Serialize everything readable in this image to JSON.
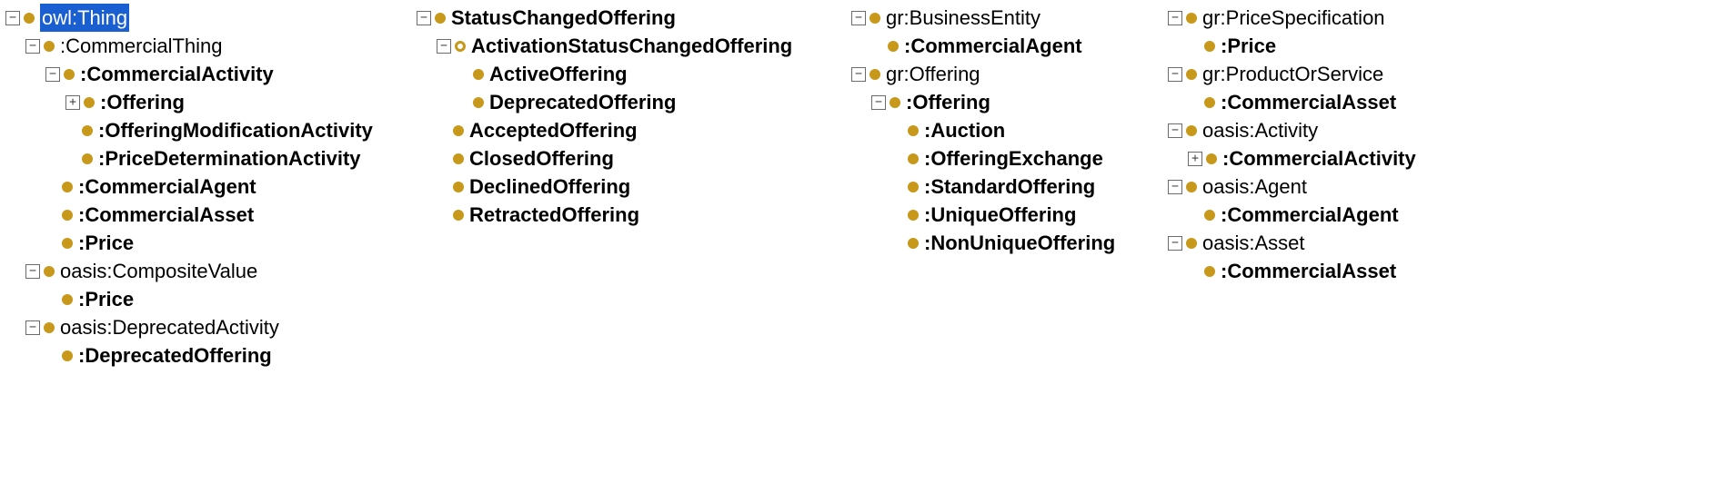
{
  "col1": {
    "owlThing": "owl:Thing",
    "commercialThing": ":CommercialThing",
    "commercialActivity": ":CommercialActivity",
    "offering": ":Offering",
    "offeringModificationActivity": ":OfferingModificationActivity",
    "priceDeterminationActivity": ":PriceDeterminationActivity",
    "commercialAgent": ":CommercialAgent",
    "commercialAsset": ":CommercialAsset",
    "price": ":Price",
    "compositeValue": "oasis:CompositeValue",
    "price2": ":Price",
    "deprecatedActivity": "oasis:DeprecatedActivity",
    "deprecatedOffering": ":DeprecatedOffering"
  },
  "col2": {
    "statusChangedOffering": "StatusChangedOffering",
    "activationStatusChangedOffering": "ActivationStatusChangedOffering",
    "activeOffering": "ActiveOffering",
    "deprecatedOffering": "DeprecatedOffering",
    "acceptedOffering": "AcceptedOffering",
    "closedOffering": "ClosedOffering",
    "declinedOffering": "DeclinedOffering",
    "retractedOffering": "RetractedOffering"
  },
  "col3": {
    "businessEntity": "gr:BusinessEntity",
    "commercialAgent": ":CommercialAgent",
    "grOffering": "gr:Offering",
    "offering": ":Offering",
    "auction": ":Auction",
    "offeringExchange": ":OfferingExchange",
    "standardOffering": ":StandardOffering",
    "uniqueOffering": ":UniqueOffering",
    "nonUniqueOffering": ":NonUniqueOffering"
  },
  "col4": {
    "priceSpecification": "gr:PriceSpecification",
    "price": ":Price",
    "productOrService": "gr:ProductOrService",
    "commercialAsset": ":CommercialAsset",
    "oasisActivity": "oasis:Activity",
    "commercialActivity": ":CommercialActivity",
    "oasisAgent": "oasis:Agent",
    "commercialAgent": ":CommercialAgent",
    "oasisAsset": "oasis:Asset",
    "commercialAsset2": ":CommercialAsset"
  }
}
